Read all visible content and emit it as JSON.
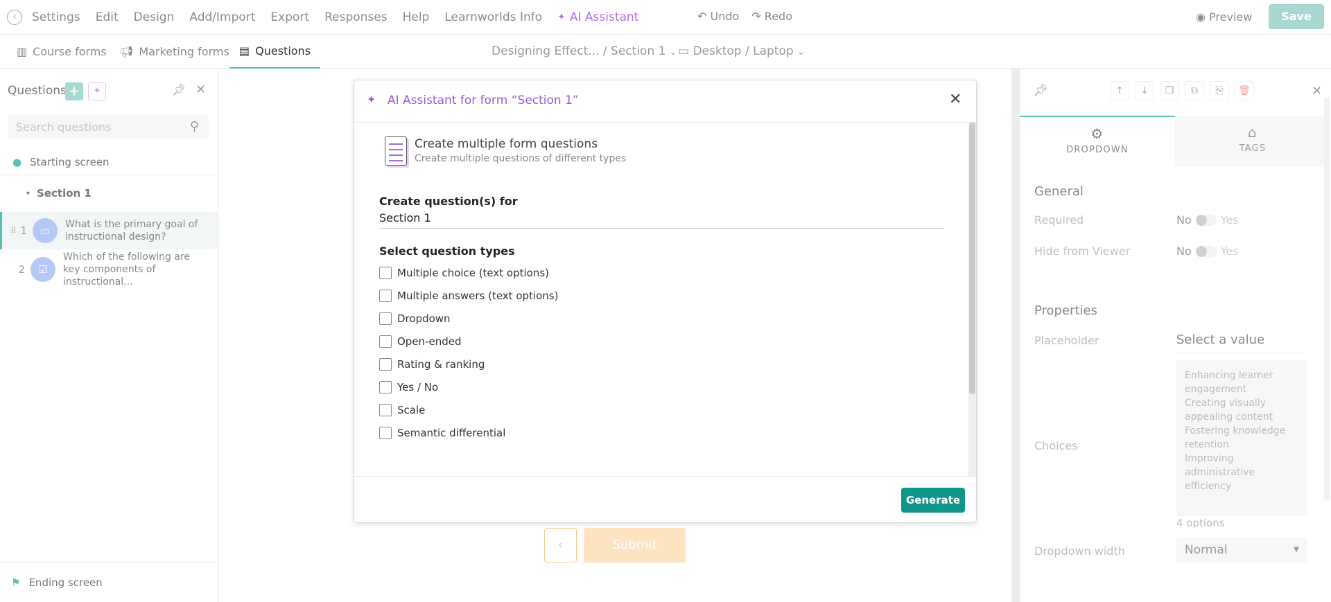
{
  "topbar": {
    "back_icon": "arrow-left-circle-icon",
    "menu": [
      "Settings",
      "Edit",
      "Design",
      "Add/Import",
      "Export",
      "Responses",
      "Help",
      "Learnworlds Info"
    ],
    "ai_assistant": "AI Assistant",
    "undo": "Undo",
    "redo": "Redo",
    "preview": "Preview",
    "save": "Save"
  },
  "subbar": {
    "tabs": [
      "Course forms",
      "Marketing forms",
      "Questions"
    ],
    "breadcrumb": "Designing Effect... / Section 1",
    "device": "Desktop / Laptop"
  },
  "left": {
    "title": "Questions",
    "search_placeholder": "Search questions",
    "starting_screen": "Starting screen",
    "section": "Section 1",
    "questions": [
      {
        "num": "1",
        "text": "What is the primary goal of instructional design?"
      },
      {
        "num": "2",
        "text": "Which of the following are key components of instructional..."
      }
    ],
    "ending_screen": "Ending screen"
  },
  "canvas": {
    "prev": "‹",
    "submit": "Submit"
  },
  "right": {
    "tabs": [
      "DROPDOWN",
      "TAGS"
    ],
    "general": "General",
    "required": "Required",
    "hide": "Hide from Viewer",
    "no": "No",
    "yes": "Yes",
    "properties": "Properties",
    "placeholder_label": "Placeholder",
    "placeholder_value": "Select a value",
    "choices_label": "Choices",
    "choices": [
      "Enhancing learner engagement",
      "Creating visually appealing content",
      "Fostering knowledge retention",
      "Improving administrative efficiency"
    ],
    "options_count": "4 options",
    "dropdown_width_label": "Dropdown width",
    "dropdown_width_value": "Normal"
  },
  "modal": {
    "title": "AI Assistant for form “Section 1”",
    "task_title": "Create multiple form questions",
    "task_subtitle": "Create multiple questions of different types",
    "create_label": "Create question(s) for",
    "create_value": "Section 1",
    "types_label": "Select question types",
    "types": [
      "Multiple choice (text options)",
      "Multiple answers (text options)",
      "Dropdown",
      "Open-ended",
      "Rating & ranking",
      "Yes / No",
      "Scale",
      "Semantic differential"
    ],
    "generate": "Generate"
  }
}
